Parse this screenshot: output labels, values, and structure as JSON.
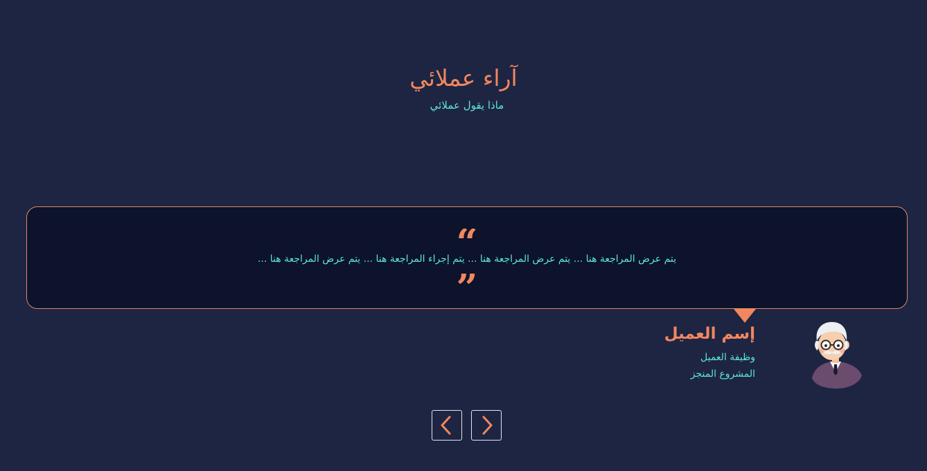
{
  "section": {
    "title": "آراء عملائي",
    "subtitle": "ماذا يقول عملائي"
  },
  "testimonial": {
    "open_quote_icon": "quote-open-icon",
    "close_quote_icon": "quote-close-icon",
    "text": "يتم عرض المراجعة هنا ... يتم عرض المراجعة هنا ... يتم إجراء المراجعة هنا ... يتم عرض المراجعة هنا ...",
    "client": {
      "name": "إسم العميل",
      "job": "وظيفة العميل",
      "project": "المشروع المنجز",
      "avatar_icon": "old-man-avatar-icon"
    }
  },
  "navigation": {
    "prev_icon": "chevron-left-icon",
    "next_icon": "chevron-right-icon"
  },
  "colors": {
    "background": "#1e2542",
    "card": "#0c132b",
    "accent": "#f2875f",
    "text_teal": "#5ee6d8"
  }
}
